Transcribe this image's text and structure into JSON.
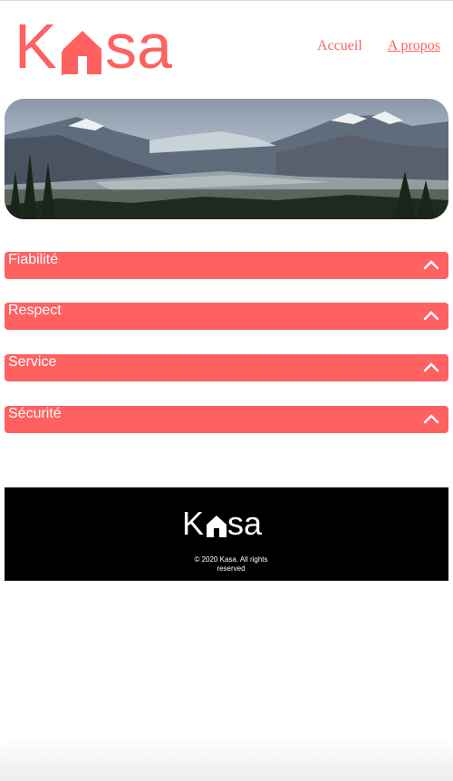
{
  "header": {
    "logo": {
      "text_k": "K",
      "text_sa": "sa",
      "icon": "house-icon",
      "color": "#FF6060"
    },
    "nav": [
      {
        "label": "Accueil",
        "active": false
      },
      {
        "label": "A propos",
        "active": true
      }
    ]
  },
  "banner": {
    "image": "mountain-landscape"
  },
  "collapses": [
    {
      "title": "Fiabilité",
      "icon": "chevron-up-icon"
    },
    {
      "title": "Respect",
      "icon": "chevron-up-icon"
    },
    {
      "title": "Service",
      "icon": "chevron-up-icon"
    },
    {
      "title": "Sécurité",
      "icon": "chevron-up-icon"
    }
  ],
  "footer": {
    "logo": {
      "text_k": "K",
      "text_sa": "sa",
      "icon": "house-icon"
    },
    "copyright": "© 2020 Kasa. All rights reserved"
  },
  "colors": {
    "accent": "#FF6060",
    "footer_bg": "#000000",
    "text_light": "#FFFFFF"
  }
}
